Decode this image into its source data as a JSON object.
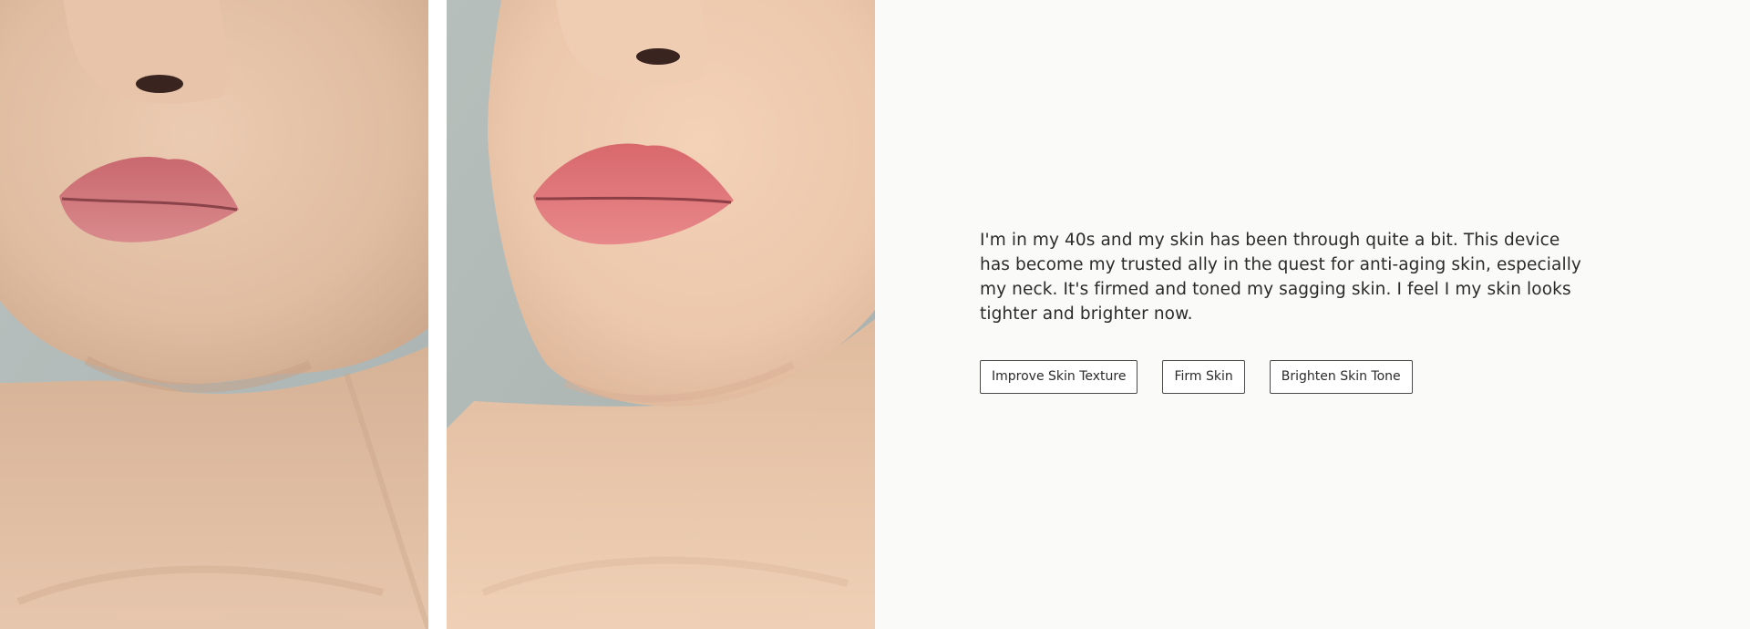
{
  "testimonial": {
    "text": "I'm in my 40s and my skin has been through quite a bit. This device has become my trusted ally in the quest for anti-aging skin, especially my neck. It's firmed and toned my sagging skin. I feel I my skin looks tighter and brighter now."
  },
  "tags": [
    {
      "label": "Improve Skin Texture"
    },
    {
      "label": "Firm Skin"
    },
    {
      "label": "Brighten Skin Tone"
    }
  ],
  "colors": {
    "page_background": "#fafaf8",
    "text": "#2b2b2b",
    "tag_border": "#4a4a4a",
    "skin_before": "#e3c0a4",
    "skin_after": "#ecc7ab",
    "lips": "#d97c80"
  }
}
